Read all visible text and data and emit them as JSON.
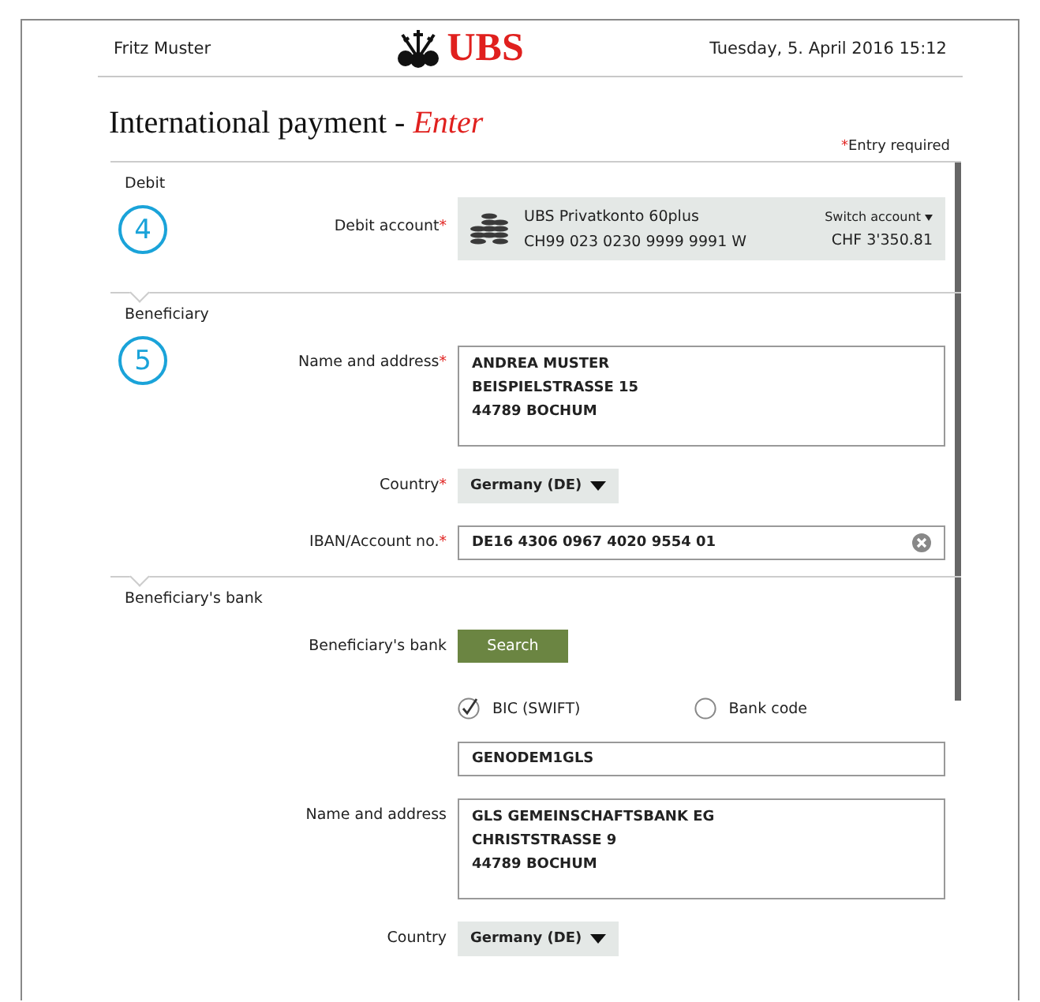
{
  "header": {
    "user": "Fritz Muster",
    "brand": "UBS",
    "datetime": "Tuesday, 5. April 2016 15:12"
  },
  "title": {
    "main": "International payment -",
    "step": "Enter"
  },
  "required_note": {
    "mark": "*",
    "text": "Entry required"
  },
  "sections": [
    {
      "title": "Debit",
      "number": "4",
      "fields": [
        {
          "kind": "account",
          "label": "Debit account",
          "required": true,
          "name": "UBS Privatkonto 60plus",
          "iban": "CH99 023 0230 9999 9991 W",
          "switch": "Switch account",
          "balance": "CHF 3'350.81"
        }
      ]
    },
    {
      "title": "Beneficiary",
      "number": "5",
      "fields": [
        {
          "kind": "textarea",
          "label": "Name and address",
          "required": true,
          "lines": [
            "ANDREA MUSTER",
            "BEISPIELSTRASSE 15",
            "44789 BOCHUM"
          ]
        },
        {
          "kind": "select",
          "label": "Country",
          "required": true,
          "value": "Germany (DE)"
        },
        {
          "kind": "input",
          "label": "IBAN/Account no.",
          "required": true,
          "value": "DE16 4306 0967 4020 9554 01",
          "clearable": true
        }
      ]
    },
    {
      "title": "Beneficiary's bank",
      "fields": [
        {
          "kind": "button",
          "label": "Beneficiary's bank",
          "required": false,
          "text": "Search"
        },
        {
          "kind": "radios",
          "options": [
            {
              "label": "BIC (SWIFT)",
              "selected": true
            },
            {
              "label": "Bank code",
              "selected": false
            }
          ]
        },
        {
          "kind": "input",
          "value": "GENODEM1GLS",
          "clearable": false
        },
        {
          "kind": "textarea",
          "label": "Name and address",
          "required": false,
          "lines": [
            "GLS GEMEINSCHAFTSBANK EG",
            "CHRISTSTRASSE 9",
            "44789 BOCHUM"
          ]
        },
        {
          "kind": "select",
          "label": "Country",
          "required": false,
          "value": "Germany (DE)"
        }
      ]
    }
  ]
}
